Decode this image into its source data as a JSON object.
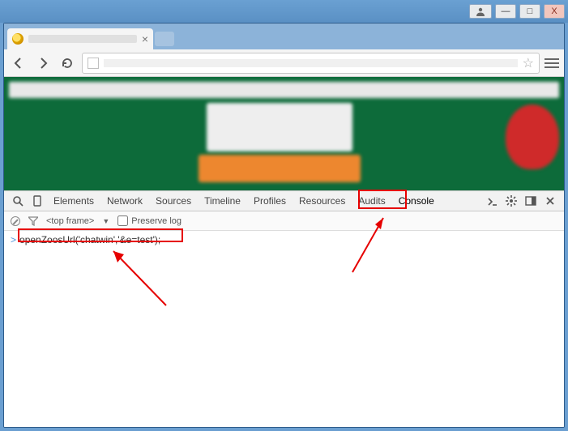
{
  "window": {
    "minimize": "—",
    "maximize": "□",
    "close": "X"
  },
  "browser": {
    "tab_close": "×",
    "star": "☆"
  },
  "devtools": {
    "tabs": {
      "elements": "Elements",
      "network": "Network",
      "sources": "Sources",
      "timeline": "Timeline",
      "profiles": "Profiles",
      "resources": "Resources",
      "audits": "Audits",
      "console": "Console"
    },
    "sub": {
      "top_frame": "<top frame>",
      "dropdown_caret": "▼",
      "preserve_log": "Preserve log"
    },
    "console": {
      "prompt": ">",
      "input": "openZoosUrl('chatwin','&e=test');"
    }
  }
}
